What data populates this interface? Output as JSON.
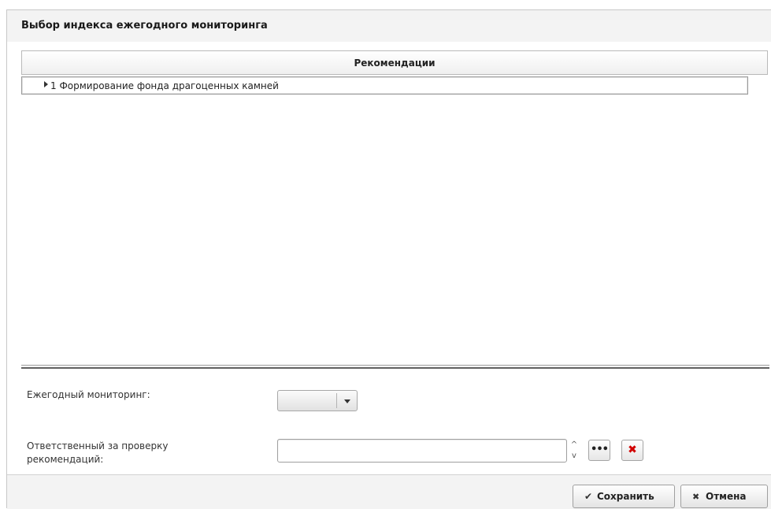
{
  "dialog": {
    "title": "Выбор индекса ежегодного мониторинга"
  },
  "grid": {
    "header": "Рекомендации",
    "rows": [
      {
        "label": "1 Формирование фонда драгоценных камней",
        "expanded": false
      }
    ]
  },
  "form": {
    "annual_monitoring": {
      "label": "Ежегодный мониторинг:",
      "value": ""
    },
    "responsible": {
      "label": "Ответственный за проверку рекомендаций:",
      "value": "",
      "placeholder": ""
    }
  },
  "footer": {
    "save_label": "Сохранить",
    "cancel_label": "Отмена"
  },
  "icons": {
    "spin_up": "^",
    "spin_down": "v",
    "ellipsis": "•••",
    "clear": "✖",
    "check": "✔",
    "cancel": "✖"
  },
  "colors": {
    "clear_icon": "#d10000",
    "title_bar": "#f3f3f3",
    "footer": "#f3f3f3"
  }
}
